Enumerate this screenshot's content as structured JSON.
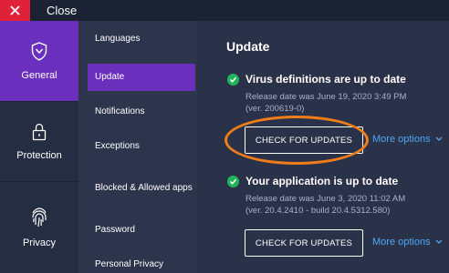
{
  "titlebar": {
    "close_label": "Close"
  },
  "nav": {
    "items": [
      {
        "label": "General",
        "icon": "shield-icon"
      },
      {
        "label": "Protection",
        "icon": "lock-icon"
      },
      {
        "label": "Privacy",
        "icon": "fingerprint-icon"
      }
    ]
  },
  "subnav": {
    "items": [
      "Languages",
      "Update",
      "Notifications",
      "Exceptions",
      "Blocked & Allowed apps",
      "Password",
      "Personal Privacy"
    ]
  },
  "main": {
    "title": "Update",
    "sections": [
      {
        "status": "Virus definitions are up to date",
        "release": "Release date was June 19, 2020 3:49 PM",
        "version": "(ver. 200619-0)",
        "button": "CHECK FOR UPDATES",
        "more": "More options"
      },
      {
        "status": "Your application is up to date",
        "release": "Release date was June 3, 2020 11:02 AM",
        "version": "(ver. 20.4.2410 - build 20.4.5312.580)",
        "button": "CHECK FOR UPDATES",
        "more": "More options"
      }
    ]
  },
  "colors": {
    "accent": "#6b2fbd",
    "close": "#e0213a",
    "success": "#23b35c",
    "link": "#4ea7f5",
    "highlight_ring": "#f07d1a"
  }
}
